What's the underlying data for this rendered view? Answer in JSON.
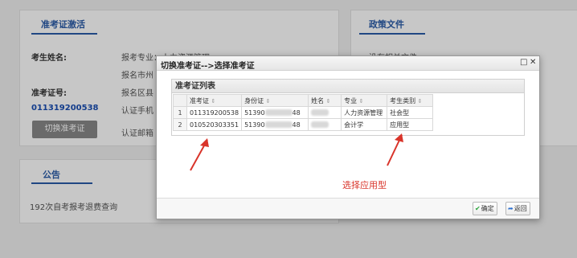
{
  "left_panel": {
    "title": "准考证激活",
    "name_label": "考生姓名:",
    "name_value": "",
    "id_label": "准考证号:",
    "id_value": "011319200538",
    "switch_button": "切换准考证",
    "info_lines": [
      "报考专业：人力资源管理",
      "报名市州",
      "报名区县",
      "认证手机",
      "认证邮箱"
    ]
  },
  "notice_panel": {
    "title": "公告",
    "item": "192次自考报考退费查询"
  },
  "policy_panel": {
    "title": "政策文件",
    "empty_text": "没有相关文件"
  },
  "dialog": {
    "title": "切换准考证-->选择准考证",
    "grid_title": "准考证列表",
    "columns": [
      "准考证",
      "身份证",
      "姓名",
      "专业",
      "考生类别"
    ],
    "rows": [
      {
        "no": "1",
        "ticket": "011319200538",
        "id_prefix": "51390",
        "id_suffix": "48",
        "major": "人力资源管理",
        "category": "社会型"
      },
      {
        "no": "2",
        "ticket": "010520303351",
        "id_prefix": "51390",
        "id_suffix": "48",
        "major": "会计学",
        "category": "应用型"
      }
    ],
    "annotation": "选择应用型",
    "ok_button": "确定",
    "back_button": "返回",
    "colors": {
      "annotation": "#d9342a",
      "title_blue": "#2a5ba8"
    }
  }
}
